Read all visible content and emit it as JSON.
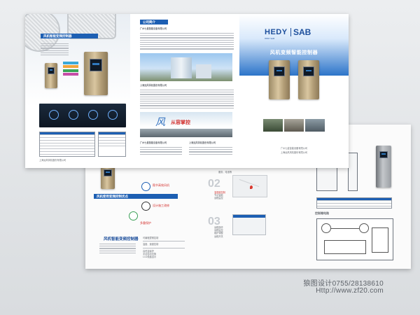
{
  "brochure": {
    "inside_left": {
      "header": "风机智能变频控制器",
      "blurb": "上海远风风机股份有限公司"
    },
    "inside_middle": {
      "section_title": "公司简介",
      "company1": "广州七星智能设备有限公司",
      "company2": "上海远风风机股份有限公司",
      "slogan_char": "风",
      "slogan_rest": "从容掌控",
      "footer_left": "广州七星智能设备有限公司",
      "footer_right": "上海远风风机股份有限公司"
    },
    "cover": {
      "logo_left": "HEDY",
      "logo_right": "SAB",
      "logo_sub": "HEDY·SAB",
      "title": "风机变频智能控制器",
      "company1": "广州七星智能设备有限公司",
      "company2": "上海远风风机股份有限公司"
    }
  },
  "back_spread": {
    "panel_left_label": "风机使用变频控制优点",
    "bubble1": "稳节高效风机",
    "bubble2": "设计施工改修",
    "bubble3": "多重保护",
    "bottom_label": "风机智能变频控制器",
    "step2": "02",
    "step3": "03",
    "step2_title": "服务、电池等",
    "step2_items": [
      "温湿度控制",
      "节点智能",
      "远程监控"
    ],
    "step3_items": [
      "远程操作",
      "远程监控",
      "维护调整",
      "远程开关"
    ],
    "right_section": "控制端电路",
    "features": [
      "可编程逻辑控制",
      "温度、速度控制",
      "高低温保护",
      "手动自动切换",
      "LCD液晶显示"
    ]
  },
  "watermark": {
    "line1": "狼图设计0755/28138610",
    "line2": "Http://www.zf20.com"
  },
  "colors": {
    "brand_blue": "#1d5fb3",
    "background": "#e3e5e7"
  }
}
